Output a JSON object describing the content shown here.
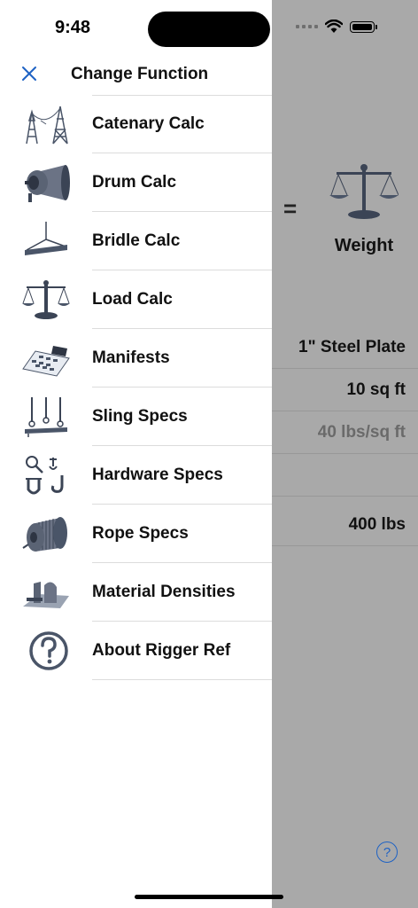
{
  "status_bar": {
    "time": "9:48"
  },
  "drawer": {
    "title": "Change Function",
    "items": [
      {
        "label": "Catenary Calc",
        "icon": "transmission-tower-icon"
      },
      {
        "label": "Drum Calc",
        "icon": "drum-winch-icon"
      },
      {
        "label": "Bridle Calc",
        "icon": "bridle-icon"
      },
      {
        "label": "Load Calc",
        "icon": "balance-scale-icon"
      },
      {
        "label": "Manifests",
        "icon": "calculator-icon"
      },
      {
        "label": "Sling Specs",
        "icon": "sling-icon"
      },
      {
        "label": "Hardware Specs",
        "icon": "shackle-hook-icon"
      },
      {
        "label": "Rope Specs",
        "icon": "rope-spool-icon"
      },
      {
        "label": "Material Densities",
        "icon": "material-shapes-icon"
      },
      {
        "label": "About Rigger Ref",
        "icon": "question-circle-icon"
      }
    ]
  },
  "background": {
    "equals": "=",
    "result_label": "Weight",
    "rows": [
      "1\" Steel Plate",
      "10 sq ft",
      "40 lbs/sq ft",
      "",
      "400 lbs"
    ]
  },
  "colors": {
    "accent": "#1e62c4",
    "dim": "#a9a9a9"
  }
}
